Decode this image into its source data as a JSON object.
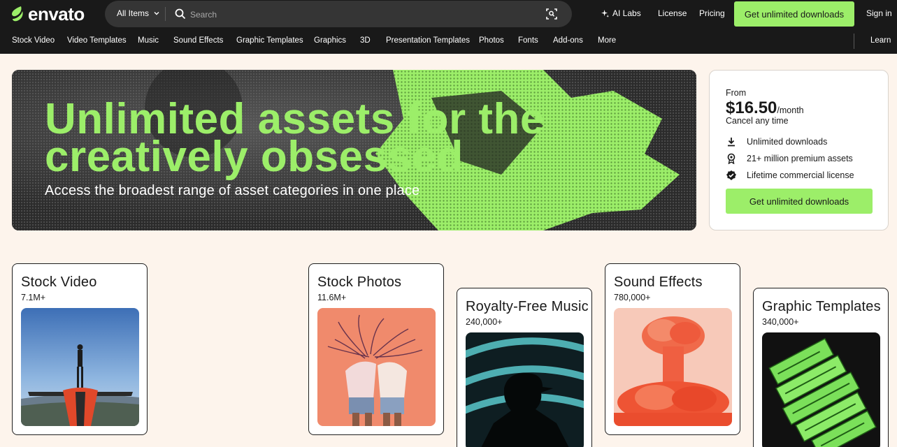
{
  "header": {
    "logo": "envato",
    "search": {
      "category": "All Items",
      "placeholder": "Search"
    },
    "links": {
      "ai_labs": "AI Labs",
      "license": "License",
      "pricing": "Pricing",
      "cta": "Get unlimited downloads",
      "sign_in": "Sign in"
    }
  },
  "category_nav": {
    "items": [
      "Stock Video",
      "Video Templates",
      "Music",
      "Sound Effects",
      "Graphic Templates",
      "Graphics",
      "3D",
      "Presentation Templates",
      "Photos",
      "Fonts",
      "Add-ons",
      "More"
    ],
    "learn": "Learn"
  },
  "hero": {
    "title_line1": "Unlimited assets for the",
    "title_line2": "creatively obsessed",
    "subtitle": "Access the broadest range of asset categories in one place"
  },
  "pricing": {
    "from": "From",
    "price": "$16.50",
    "period": "/month",
    "cancel": "Cancel any time",
    "features": [
      "Unlimited downloads",
      "21+ million premium assets",
      "Lifetime commercial license"
    ],
    "cta": "Get unlimited downloads"
  },
  "categories": [
    {
      "title": "Stock Video",
      "count": "7.1M+"
    },
    {
      "title": "Stock Photos",
      "count": "11.6M+"
    },
    {
      "title": "Royalty-Free Music",
      "count": "240,000+"
    },
    {
      "title": "Sound Effects",
      "count": "780,000+"
    },
    {
      "title": "Graphic Templates",
      "count": "340,000+"
    }
  ],
  "colors": {
    "brand_green": "#9cee69",
    "dark": "#191919",
    "page_bg": "#fdf4ec"
  },
  "icons": [
    "envato-leaf-icon",
    "chevron-down-icon",
    "search-icon",
    "image-search-icon",
    "sparkle-icon",
    "download-icon",
    "award-icon",
    "badge-check-icon"
  ]
}
